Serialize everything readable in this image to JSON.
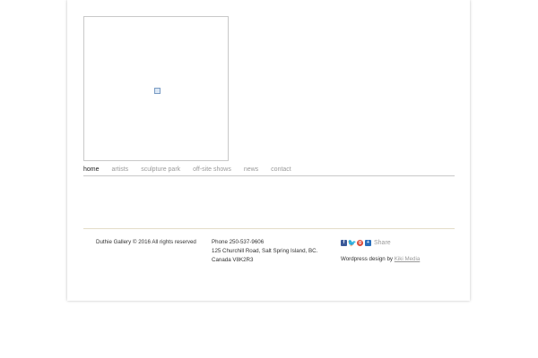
{
  "nav": {
    "items": [
      {
        "label": "home",
        "active": true
      },
      {
        "label": "artists",
        "active": false
      },
      {
        "label": "sculpture park",
        "active": false
      },
      {
        "label": "off-site shows",
        "active": false
      },
      {
        "label": "news",
        "active": false
      },
      {
        "label": "contact",
        "active": false
      }
    ]
  },
  "footer": {
    "copyright": "Duthie Gallery © 2016 All rights reserved",
    "phone": "Phone 250-537-9606",
    "address_line1": "125 Churchill Road, Salt Spring Island, BC.",
    "address_line2": "Canada V8K2R3",
    "share": {
      "label": "Share",
      "icons": [
        "facebook-icon",
        "twitter-icon",
        "google-plus-icon",
        "share-icon"
      ]
    },
    "credit_prefix": "Wordpress design by",
    "credit_link": "Kiki Media"
  },
  "colors": {
    "nav_active": "#222222",
    "nav_inactive": "#9a9a9a",
    "facebook": "#3b5998",
    "twitter": "#55acee",
    "google_plus": "#dd4b39",
    "share": "#2a6ebb"
  }
}
